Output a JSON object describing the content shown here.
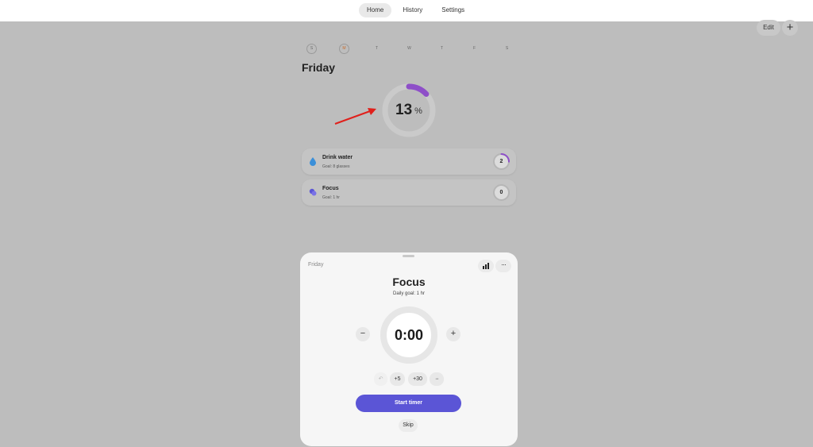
{
  "nav": {
    "tabs": [
      {
        "label": "Home",
        "active": true
      },
      {
        "label": "History",
        "active": false
      },
      {
        "label": "Settings",
        "active": false
      }
    ]
  },
  "toolbar": {
    "edit_label": "Edit",
    "add_symbol": "+"
  },
  "week": {
    "days": [
      "S",
      "M",
      "T",
      "W",
      "T",
      "F",
      "S"
    ],
    "today_index": 1,
    "ringed_indices": [
      0,
      1
    ]
  },
  "heading": "Friday",
  "progress": {
    "value": "13",
    "unit": "%",
    "fraction": 0.13,
    "accent": "#8e4fc8"
  },
  "habits": [
    {
      "name": "Drink water",
      "goal": "Goal: 8 glasses",
      "count": "2",
      "fraction": 0.25,
      "icon": "water-drop-icon"
    },
    {
      "name": "Focus",
      "goal": "Goal: 1 hr",
      "count": "0",
      "fraction": 0,
      "icon": "focus-icon"
    }
  ],
  "sheet": {
    "day": "Friday",
    "title": "Focus",
    "goal": "Daily goal: 1 hr",
    "timer": "0:00",
    "minus": "−",
    "plus": "+",
    "quick": {
      "undo": "↶",
      "plus5": "+5",
      "plus30": "+30",
      "more": "···"
    },
    "more_menu": "···",
    "start_label": "Start timer",
    "skip_label": "Skip",
    "button_color": "#5b55d6"
  },
  "annotation_color": "#e0201b"
}
